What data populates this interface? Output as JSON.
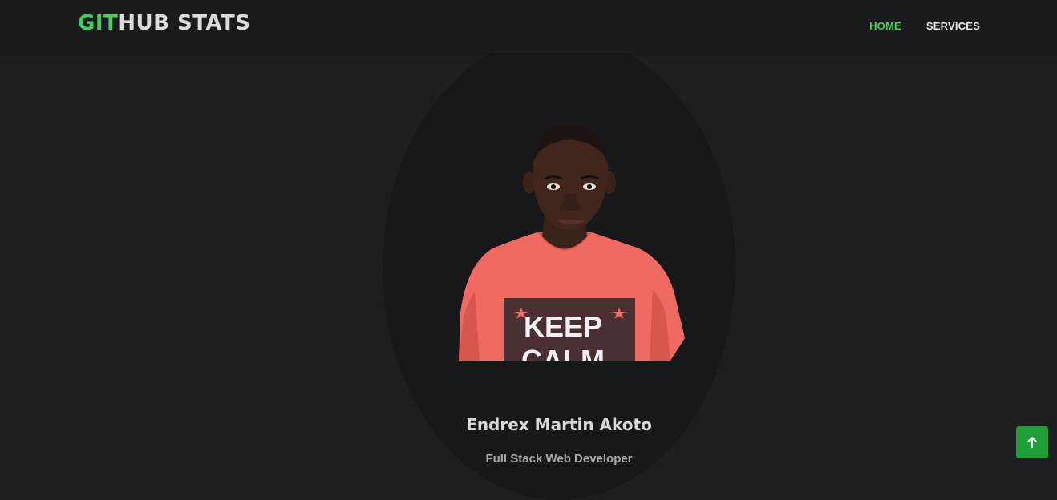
{
  "brand": {
    "accent": "GIT",
    "rest": "HUB STATS"
  },
  "nav": {
    "items": [
      {
        "label": "HOME",
        "active": true
      },
      {
        "label": "SERVICES",
        "active": false
      }
    ]
  },
  "profile": {
    "shirt_text_line1": "KEEP",
    "shirt_text_line2": "CALM",
    "name": "Endrex Martin Akoto",
    "role": "Full Stack Web Developer"
  },
  "colors": {
    "accent": "#3fd15a",
    "background": "#1d1e20",
    "navbar": "#1a1b1c",
    "button": "#1f9d37"
  },
  "icons": {
    "scroll_top": "arrow-up-icon"
  }
}
